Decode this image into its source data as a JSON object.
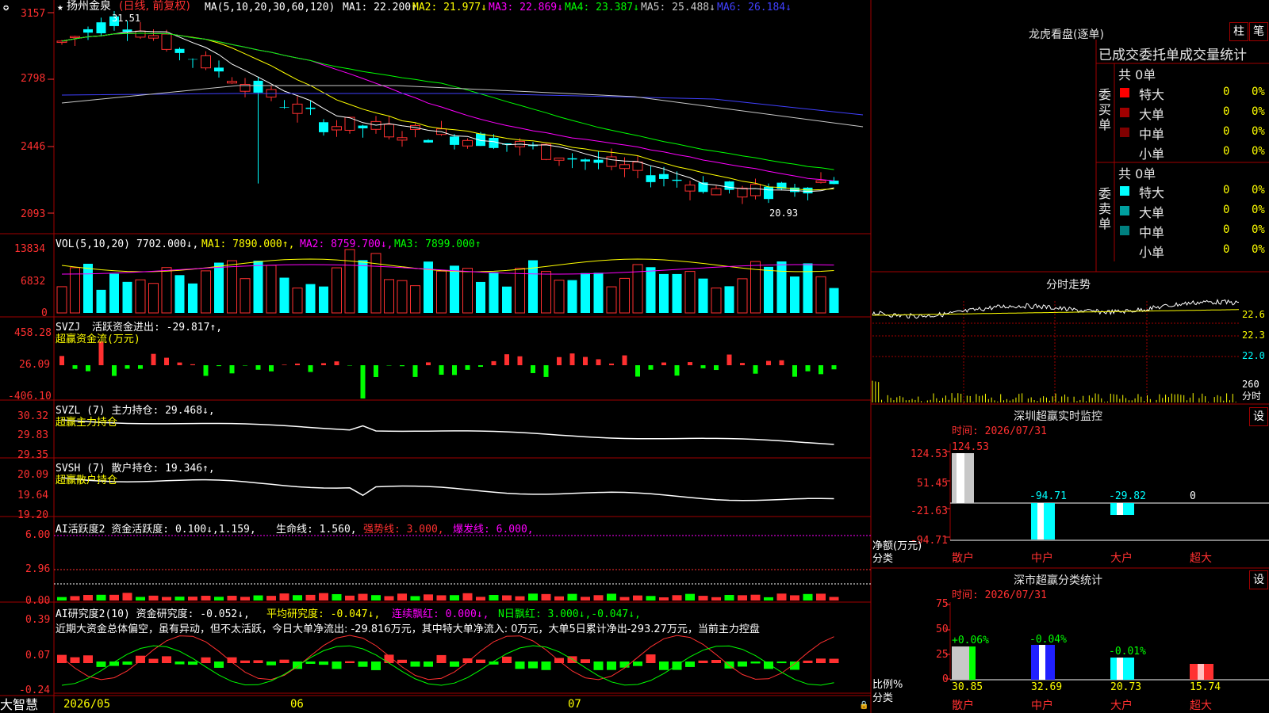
{
  "stock": {
    "name": "扬州金泉",
    "mode": "(日线, 前复权)",
    "ma_label": "MA(5,10,20,30,60,120)",
    "ma": [
      {
        "label": "MA1:",
        "value": "22.200↑",
        "color": "#ffffff"
      },
      {
        "label": "MA2:",
        "value": "21.977↓",
        "color": "#ffff00"
      },
      {
        "label": "MA3:",
        "value": "22.869↓",
        "color": "#ff00ff"
      },
      {
        "label": "MA4:",
        "value": "23.387↓",
        "color": "#00ff00"
      },
      {
        "label": "MA5:",
        "value": "25.488↓",
        "color": "#c8c8c8"
      },
      {
        "label": "MA6:",
        "value": "26.184↓",
        "color": "#4040ff"
      }
    ],
    "price_axis": [
      "3157",
      "2798",
      "2446",
      "2093"
    ],
    "high_label": "31.51",
    "low_label": "20.93",
    "logo_label": "大智慧",
    "dates": [
      "2026/05",
      "06",
      "07"
    ]
  },
  "vol": {
    "header": "VOL(5,10,20)",
    "value": "7702.000↓,",
    "ma1": "MA1: 7890.000↑,",
    "ma2": "MA2: 8759.700↓,",
    "ma3": "MA3: 7899.000↑",
    "axis": [
      "13834",
      "6832",
      "0"
    ]
  },
  "svzj": {
    "header": "SVZJ",
    "text": "活跃资金进出: -29.817↑,",
    "sub": "超赢资金流(万元)",
    "axis": [
      "458.28",
      "26.09",
      "-406.10"
    ]
  },
  "svzl": {
    "header": "SVZL (7) 主力持仓: 29.468↓,",
    "sub": "超赢主力持仓",
    "axis": [
      "30.32",
      "29.83",
      "29.35"
    ]
  },
  "svsh": {
    "header": "SVSH (7) 散户持仓: 19.346↑,",
    "sub": "超赢散户持仓",
    "axis": [
      "20.09",
      "19.64",
      "19.20"
    ]
  },
  "ai1": {
    "header": "AI活跃度2 资金活跃度: 0.100↓,1.159,",
    "life": "生命线: 1.560,",
    "strong": "强势线: 3.000,",
    "burst": "爆发线: 6.000,",
    "axis": [
      "6.00",
      "2.96",
      "0.00"
    ]
  },
  "ai2": {
    "header": "AI研究度2(10) 资金研究度: -0.052↓,",
    "avg": "平均研究度: -0.047↓,",
    "red": "连续飘红: 0.000↓,",
    "nred": "N日飘红: 3.000↓,-0.047↓,",
    "comment": "近期大资金总体偏空，虽有异动，但不太活跃，今日大单净流出: -29.816万元，其中特大单净流入: 0万元，大单5日累计净出-293.27万元，当前主力控盘",
    "axis": [
      "0.39",
      "0.07",
      "-0.24"
    ]
  },
  "lhb": {
    "title": "龙虎看盘(逐单)",
    "btn1": "柱",
    "btn2": "笔",
    "header": "已成交委托单成交量统计",
    "buy_label": "委买单",
    "sell_label": "委卖单",
    "buy_total": "共 0单",
    "sell_total": "共 0单",
    "buy_rows": [
      {
        "name": "特大",
        "count": "0",
        "pct": "0%",
        "color": "#ff0000"
      },
      {
        "name": "大单",
        "count": "0",
        "pct": "0%",
        "color": "#a00000"
      },
      {
        "name": "中单",
        "count": "0",
        "pct": "0%",
        "color": "#800000"
      },
      {
        "name": "小单",
        "count": "0",
        "pct": "0%",
        "color": "#000000"
      }
    ],
    "sell_rows": [
      {
        "name": "特大",
        "count": "0",
        "pct": "0%",
        "color": "#00ffff"
      },
      {
        "name": "大单",
        "count": "0",
        "pct": "0%",
        "color": "#00a0a0"
      },
      {
        "name": "中单",
        "count": "0",
        "pct": "0%",
        "color": "#008080"
      },
      {
        "name": "小单",
        "count": "0",
        "pct": "0%",
        "color": "#000000"
      }
    ]
  },
  "intraday": {
    "title": "分时走势",
    "axis": [
      "22.6",
      "22.3",
      "22.0",
      "260",
      "分时"
    ]
  },
  "monitor": {
    "title": "深圳超赢实时监控",
    "btn": "设",
    "time": "时间: 2026/07/31",
    "axis": [
      "124.53",
      "51.45",
      "-21.63",
      "-94.71"
    ],
    "net_label": "净额(万元)",
    "cat_label": "分类",
    "values": [
      "124.53",
      "-94.71",
      "-29.82",
      "0"
    ],
    "cats": [
      "散户",
      "中户",
      "大户",
      "超大"
    ]
  },
  "stats": {
    "title": "深市超赢分类统计",
    "btn": "设",
    "time": "时间: 2026/07/31",
    "axis": [
      "75",
      "50",
      "25",
      "0"
    ],
    "ratio_label": "比例%",
    "cat_label": "分类",
    "deltas": [
      "+0.06%",
      "-0.04%",
      "-0.01%"
    ],
    "values": [
      "30.85",
      "32.69",
      "20.73",
      "15.74"
    ],
    "cats": [
      "散户",
      "中户",
      "大户",
      "超大"
    ]
  }
}
